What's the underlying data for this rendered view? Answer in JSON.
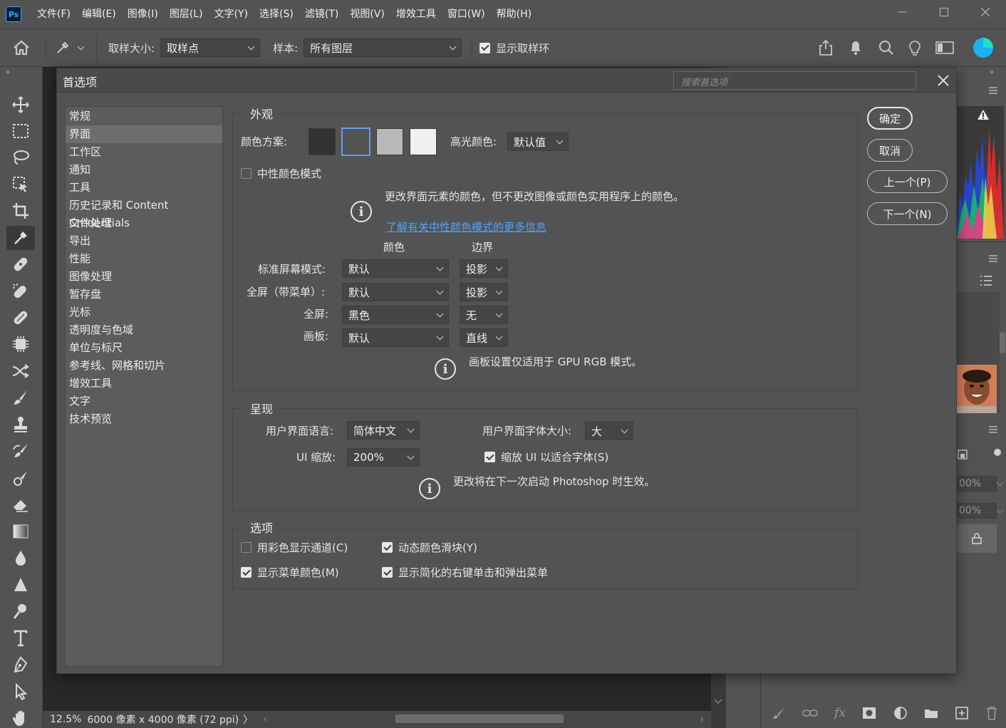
{
  "app": {
    "logo": "Ps",
    "menu": [
      "文件(F)",
      "编辑(E)",
      "图像(I)",
      "图层(L)",
      "文字(Y)",
      "选择(S)",
      "滤镜(T)",
      "视图(V)",
      "增效工具",
      "窗口(W)",
      "帮助(H)"
    ]
  },
  "options_bar": {
    "sample_size_label": "取样大小:",
    "sample_size_value": "取样点",
    "sample_label": "样本:",
    "sample_value": "所有图层",
    "show_ring_label": "显示取样环",
    "show_ring_checked": true
  },
  "status_bar": {
    "zoom": "12.5%",
    "doc_info": "6000 像素 x 4000 像素 (72 ppi)",
    "arrow": "〉"
  },
  "right_panel": {
    "opacity1": "00%",
    "opacity2": "00%"
  },
  "dialog": {
    "title": "首选项",
    "search_placeholder": "搜索首选项",
    "categories": [
      "常规",
      "界面",
      "工作区",
      "通知",
      "工具",
      "历史记录和 Content Credentials",
      "文件处理",
      "导出",
      "性能",
      "图像处理",
      "暂存盘",
      "光标",
      "透明度与色域",
      "单位与标尺",
      "参考线、网格和切片",
      "增效工具",
      "文字",
      "技术预览"
    ],
    "selected_category": "界面",
    "buttons": {
      "ok": "确定",
      "cancel": "取消",
      "prev": "上一个(P)",
      "next": "下一个(N)"
    },
    "appearance": {
      "legend": "外观",
      "color_theme_label": "颜色方案:",
      "swatch_colors": [
        "#323232",
        "#535353",
        "#b8b8b8",
        "#f0f0f0"
      ],
      "highlight_label": "高光颜色:",
      "highlight_value": "默认值",
      "neutral_mode_label": "中性颜色模式",
      "neutral_mode_checked": false,
      "neutral_info": "更改界面元素的颜色，但不更改图像或颜色实用程序上的颜色。",
      "learn_more": "了解有关中性颜色模式的更多信息",
      "col_color": "颜色",
      "col_border": "边界",
      "rows": [
        {
          "label": "标准屏幕模式:",
          "color": "默认",
          "border": "投影"
        },
        {
          "label": "全屏（带菜单）:",
          "color": "默认",
          "border": "投影"
        },
        {
          "label": "全屏:",
          "color": "黑色",
          "border": "无"
        },
        {
          "label": "画板:",
          "color": "默认",
          "border": "直线"
        }
      ],
      "artboard_info": "画板设置仅适用于 GPU RGB 模式。"
    },
    "presentation": {
      "legend": "呈现",
      "ui_language_label": "用户界面语言:",
      "ui_language_value": "简体中文",
      "ui_font_size_label": "用户界面字体大小:",
      "ui_font_size_value": "大",
      "ui_scale_label": "UI 缩放:",
      "ui_scale_value": "200%",
      "scale_to_font_label": "缩放 UI 以适合字体(S)",
      "scale_to_font_checked": true,
      "restart_info": "更改将在下一次启动 Photoshop 时生效。"
    },
    "options": {
      "legend": "选项",
      "items": [
        {
          "label": "用彩色显示通道(C)",
          "checked": false
        },
        {
          "label": "动态颜色滑块(Y)",
          "checked": true
        },
        {
          "label": "显示菜单颜色(M)",
          "checked": true
        },
        {
          "label": "显示简化的右键单击和弹出菜单",
          "checked": true
        }
      ]
    }
  }
}
